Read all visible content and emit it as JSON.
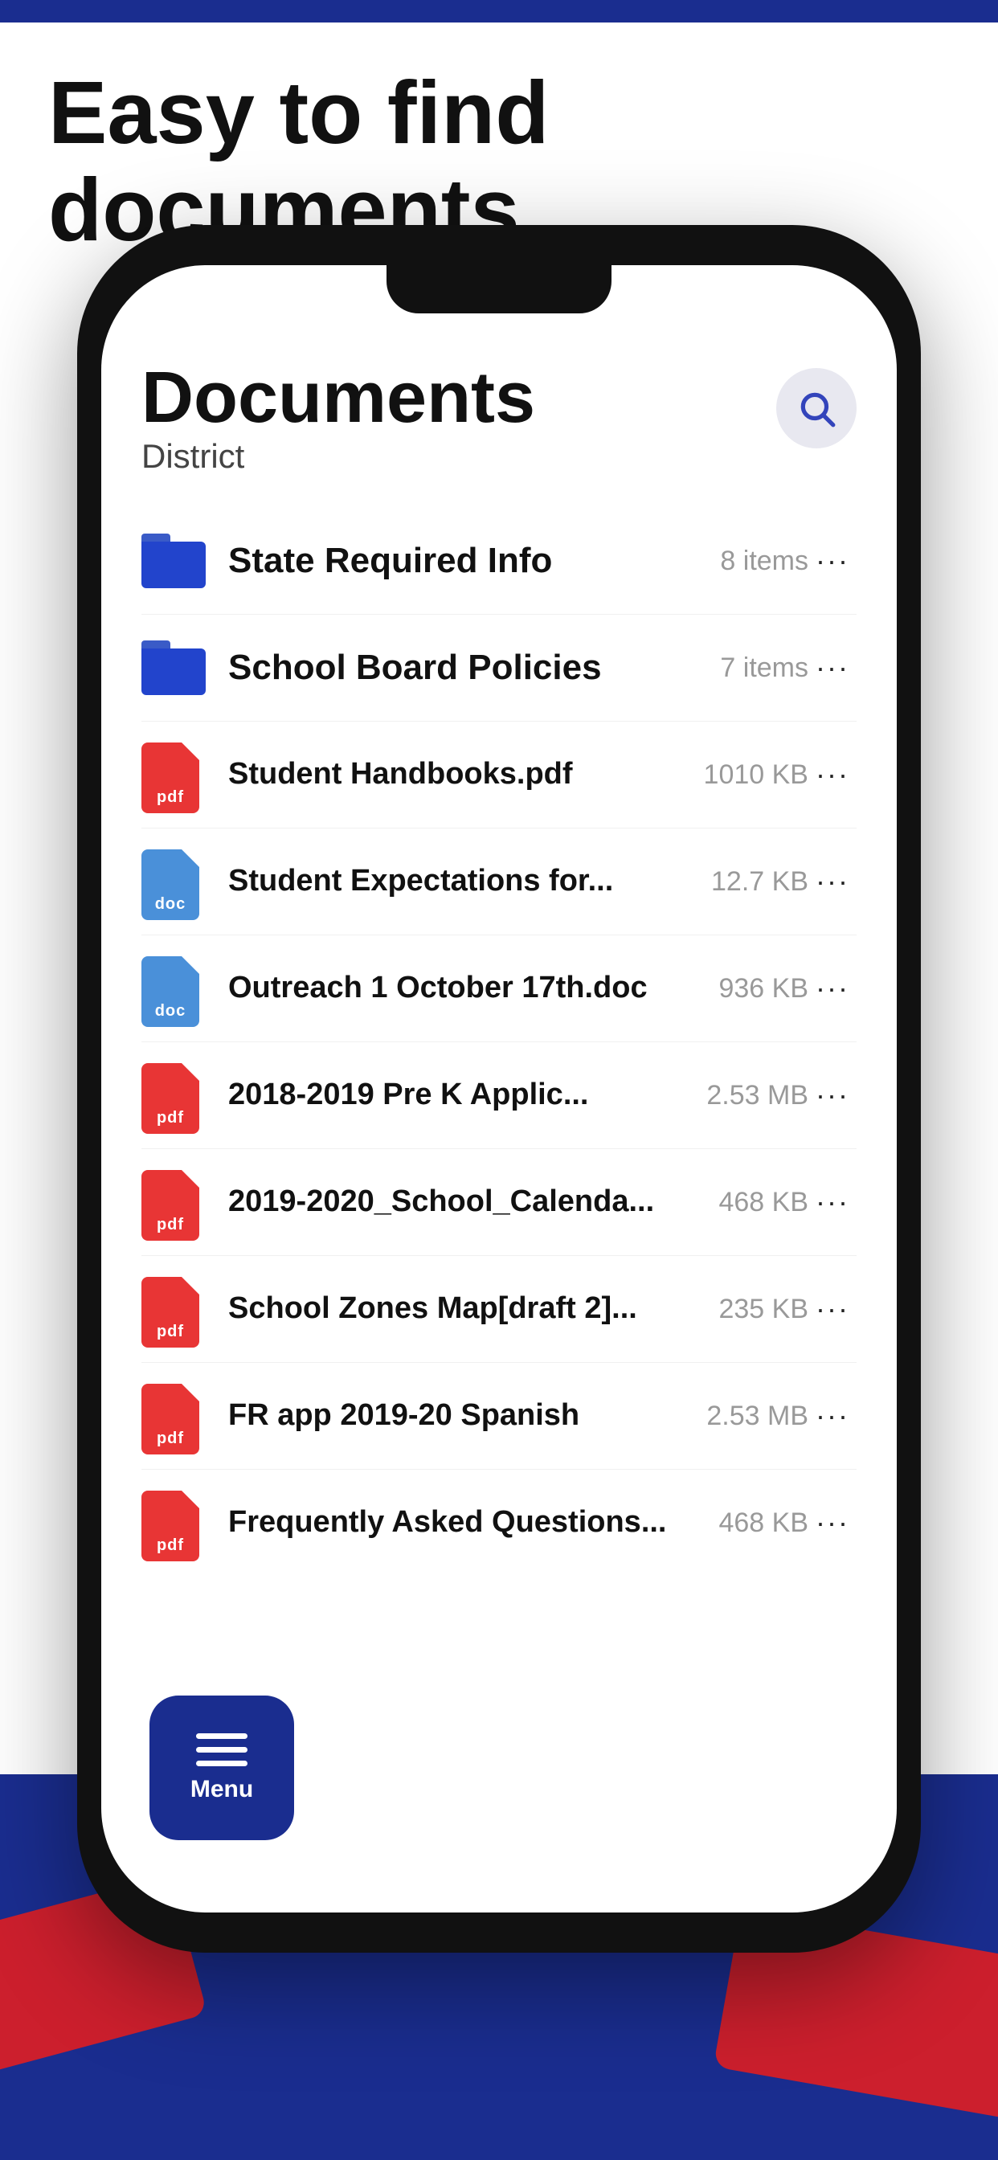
{
  "page": {
    "title": "Easy to find documents",
    "top_bar_color": "#1a2d8f",
    "bottom_bg_color": "#1a2d8f",
    "red_accent_color": "#cc1f2d"
  },
  "phone": {
    "header": {
      "title": "Documents",
      "subtitle": "District",
      "search_label": "search"
    },
    "items": [
      {
        "id": "folder-state",
        "type": "folder",
        "name": "State Required Info",
        "size": "8 items"
      },
      {
        "id": "folder-school",
        "type": "folder",
        "name": "School Board Policies",
        "size": "7 items"
      },
      {
        "id": "pdf-student-handbooks",
        "type": "pdf",
        "name": "Student Handbooks.pdf",
        "size": "1010 KB"
      },
      {
        "id": "doc-student-expectations",
        "type": "doc",
        "name": "Student Expectations for...",
        "size": "12.7 KB"
      },
      {
        "id": "doc-outreach",
        "type": "doc",
        "name": "Outreach 1 October 17th.doc",
        "size": "936 KB"
      },
      {
        "id": "pdf-pre-k",
        "type": "pdf",
        "name": "2018-2019 Pre K Applic...",
        "size": "2.53 MB"
      },
      {
        "id": "pdf-school-calendar",
        "type": "pdf",
        "name": "2019-2020_School_Calenda...",
        "size": "468 KB"
      },
      {
        "id": "pdf-school-zones",
        "type": "pdf",
        "name": "School Zones Map[draft 2]...",
        "size": "235 KB"
      },
      {
        "id": "pdf-fr-app",
        "type": "pdf",
        "name": "FR app 2019-20 Spanish",
        "size": "2.53 MB"
      },
      {
        "id": "pdf-faq",
        "type": "pdf",
        "name": "Frequently Asked Questions...",
        "size": "468 KB"
      }
    ],
    "menu": {
      "label": "Menu"
    }
  }
}
